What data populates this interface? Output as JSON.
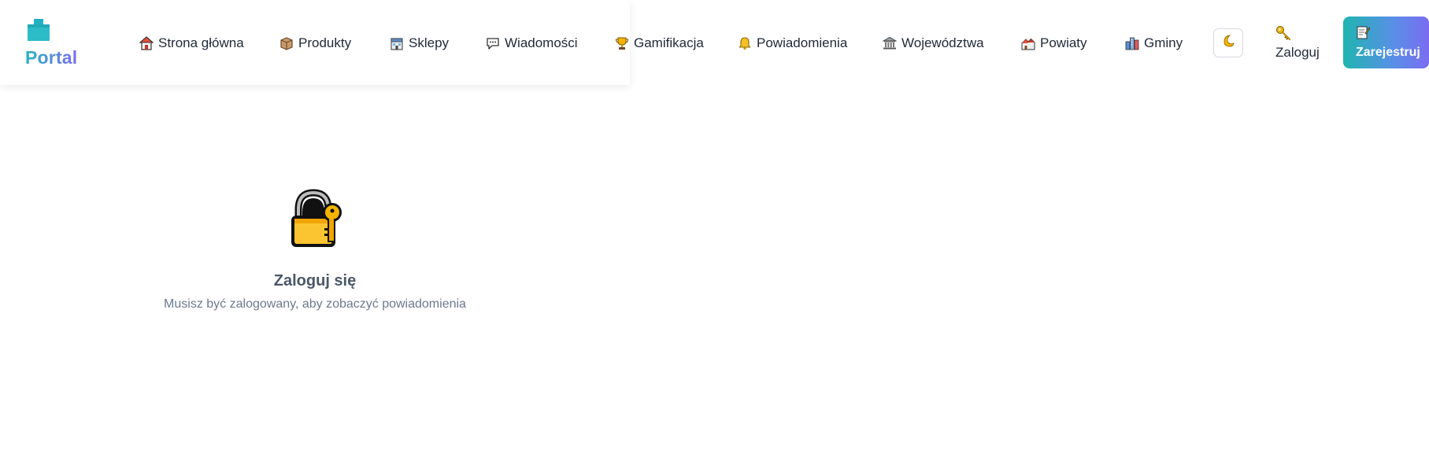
{
  "header": {
    "logo": {
      "text": "Portal",
      "icon": "building-icon"
    },
    "nav": [
      {
        "label": "Strona główna",
        "icon": "house-icon"
      },
      {
        "label": "Produkty",
        "icon": "package-icon"
      },
      {
        "label": "Sklepy",
        "icon": "store-icon"
      },
      {
        "label": "Wiadomości",
        "icon": "speech-bubble-icon"
      },
      {
        "label": "Gamifikacja",
        "icon": "trophy-icon"
      },
      {
        "label": "Powiadomienia",
        "icon": "bell-icon"
      },
      {
        "label": "Województwa",
        "icon": "classical-building-icon"
      },
      {
        "label": "Powiaty",
        "icon": "houses-icon"
      },
      {
        "label": "Gminy",
        "icon": "cityscape-icon"
      }
    ],
    "theme_toggle": {
      "icon": "moon-icon"
    },
    "login": {
      "label": "Zaloguj",
      "icon": "key-icon"
    },
    "register": {
      "label": "Zarejestruj",
      "icon": "memo-icon"
    }
  },
  "main": {
    "empty_state": {
      "icon": "lock-with-key-icon",
      "title": "Zaloguj się",
      "description": "Musisz być zalogowany, aby zobaczyć powiadomienia"
    }
  },
  "colors": {
    "brand_start": "#2bb3c0",
    "brand_end": "#7a6cf0",
    "text": "#1f2937",
    "muted": "#6b7a8f"
  }
}
